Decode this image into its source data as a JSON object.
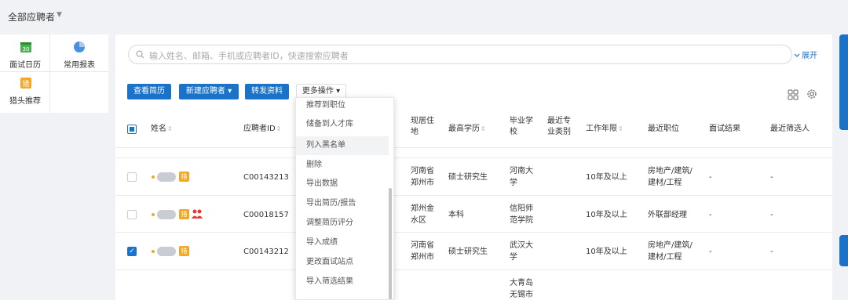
{
  "topbar": {
    "title": "全部应聘者",
    "caret": "▼"
  },
  "quick_links": [
    {
      "label": "面试日历",
      "icon": "calendar-icon",
      "badge": "30"
    },
    {
      "label": "常用报表",
      "icon": "pie-chart-icon"
    },
    {
      "label": "猎头推荐",
      "icon": "headhunter-icon",
      "badge": "猎"
    }
  ],
  "search": {
    "placeholder": "输入姓名、邮箱、手机或应聘者ID，快速搜索应聘者",
    "expand_label": "展开"
  },
  "toolbar": {
    "view_resume": "查看简历",
    "new_candidate": "新建应聘者 ▾",
    "forward": "转发资料",
    "more": "更多操作 ▾"
  },
  "columns": {
    "name": "姓名",
    "id": "应聘者ID",
    "residence": "现居住地",
    "education": "最高学历",
    "school": "毕业学校",
    "major_type": "最近专业类别",
    "years": "工作年限",
    "position": "最近职位",
    "interview": "面试结果",
    "screener": "最近筛选人"
  },
  "sort_glyph": "⇕",
  "rows": [
    {
      "id": "C00143213",
      "residence": "河南省\n郑州市",
      "education": "硕士研究生",
      "school": "河南大\n学",
      "years": "10年及以上",
      "position": "房地产/建筑/\n建材/工程",
      "interview": "-",
      "screener": "-",
      "checked": false,
      "hunter_badge": "猎",
      "has_people": false
    },
    {
      "id": "C00018157",
      "residence": "郑州金\n水区",
      "education": "本科",
      "school": "信阳师\n范学院",
      "years": "10年及以上",
      "position": "外联部经理",
      "interview": "-",
      "screener": "-",
      "checked": false,
      "hunter_badge": "猎",
      "has_people": true
    },
    {
      "id": "C00143212",
      "residence": "河南省\n郑州市",
      "education": "硕士研究生",
      "school": "武汉大\n学",
      "years": "10年及以上",
      "position": "房地产/建筑/\n建材/工程",
      "interview": "-",
      "screener": "-",
      "checked": true,
      "hunter_badge": "猎",
      "has_people": false
    }
  ],
  "partial_row": {
    "school": "大青岛\n无锡市"
  },
  "more_menu": [
    "推荐到职位",
    "储备到人才库",
    "列入黑名单",
    "删除",
    "导出数据",
    "导出简历/报告",
    "调整简历评分",
    "导入成绩",
    "更改面试站点",
    "导入筛选结果"
  ],
  "colors": {
    "primary": "#1a73c8",
    "hunter": "#f5a623",
    "people": "#e03b3b",
    "calendar": "#4caf50"
  }
}
